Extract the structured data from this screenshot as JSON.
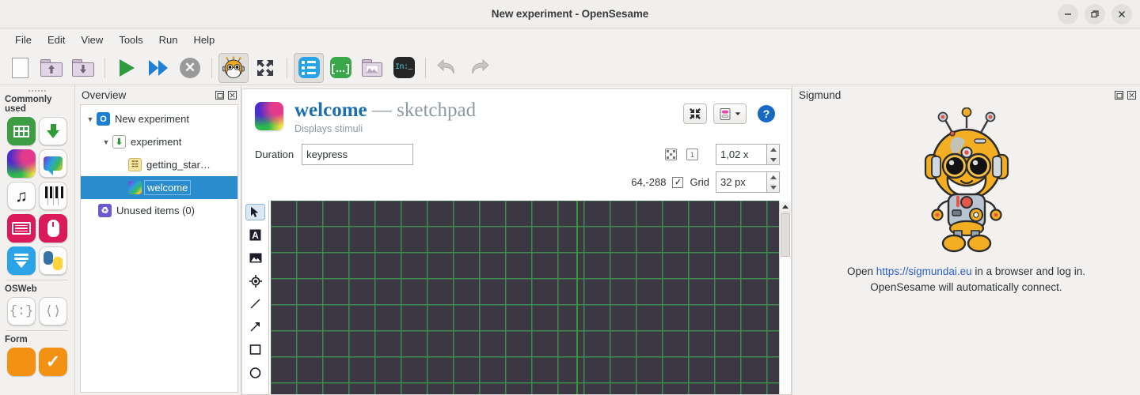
{
  "window": {
    "title": "New experiment - OpenSesame",
    "controls": [
      {
        "name": "minimize",
        "glyph": "minimize-icon"
      },
      {
        "name": "maximize",
        "glyph": "maximize-icon"
      },
      {
        "name": "close",
        "glyph": "close-icon"
      }
    ]
  },
  "menubar": {
    "items": [
      {
        "label": "File"
      },
      {
        "label": "Edit"
      },
      {
        "label": "View"
      },
      {
        "label": "Tools"
      },
      {
        "label": "Run"
      },
      {
        "label": "Help"
      }
    ]
  },
  "toolbar": {
    "buttons": [
      {
        "name": "new-file",
        "icon": "new-file-icon",
        "tooltip": "New"
      },
      {
        "name": "open-file",
        "icon": "folder-up-icon",
        "tooltip": "Open"
      },
      {
        "name": "save-file",
        "icon": "folder-down-icon",
        "tooltip": "Save"
      },
      {
        "name": "run-fullscreen",
        "icon": "play-icon",
        "tooltip": "Run fullscreen"
      },
      {
        "name": "run-in-window",
        "icon": "fast-forward-icon",
        "tooltip": "Run in window"
      },
      {
        "name": "quit-experiment",
        "icon": "stop-icon",
        "tooltip": "Quit"
      },
      {
        "name": "run-in-debug",
        "icon": "bug-icon",
        "tooltip": "Run with debugger"
      },
      {
        "name": "toggle-fullscreen-view",
        "icon": "expand-arrows-icon",
        "tooltip": "Fullscreen"
      },
      {
        "name": "toggle-overview",
        "icon": "overview-list-icon",
        "tooltip": "Overview area"
      },
      {
        "name": "toggle-variable-inspector",
        "icon": "variable-inspector-icon",
        "tooltip": "Variable inspector"
      },
      {
        "name": "toggle-file-pool",
        "icon": "file-pool-icon",
        "tooltip": "File pool"
      },
      {
        "name": "toggle-console",
        "icon": "console-icon",
        "tooltip": "Console"
      },
      {
        "name": "undo",
        "icon": "undo-icon",
        "tooltip": "Undo"
      },
      {
        "name": "redo",
        "icon": "redo-icon",
        "tooltip": "Redo"
      }
    ]
  },
  "palette": {
    "sections": [
      {
        "label": "Commonly used",
        "items": [
          {
            "name": "loop-item",
            "icon": "loop-icon"
          },
          {
            "name": "sequence-item",
            "icon": "sequence-icon"
          },
          {
            "name": "sketchpad-item",
            "icon": "sketchpad-icon"
          },
          {
            "name": "feedback-item",
            "icon": "feedback-icon"
          },
          {
            "name": "sampler-item",
            "icon": "sampler-icon"
          },
          {
            "name": "synth-item",
            "icon": "synth-icon"
          },
          {
            "name": "keyboard-response-item",
            "icon": "keyboard-icon"
          },
          {
            "name": "mouse-response-item",
            "icon": "mouse-icon"
          },
          {
            "name": "logger-item",
            "icon": "logger-icon"
          },
          {
            "name": "inline-script-item",
            "icon": "python-icon"
          }
        ]
      },
      {
        "label": "OSWeb",
        "items": [
          {
            "name": "inline-javascript-item",
            "icon": "braces-icon",
            "glyph": "{:}"
          },
          {
            "name": "inline-html-item",
            "icon": "angle-brackets-icon",
            "glyph": "⟨⟩"
          }
        ]
      },
      {
        "label": "Form",
        "items": [
          {
            "name": "form-base-item",
            "icon": "form-icon"
          },
          {
            "name": "form-consent-item",
            "icon": "form-consent-icon"
          }
        ]
      }
    ]
  },
  "overview": {
    "title": "Overview",
    "dock_buttons": [
      {
        "name": "float-overview",
        "icon": "undock-icon"
      },
      {
        "name": "close-overview",
        "icon": "close-dock-icon"
      }
    ],
    "tree": [
      {
        "label": "New experiment",
        "icon": "experiment-icon",
        "indent": 0,
        "twisty": "▼",
        "selected": false
      },
      {
        "label": "experiment",
        "icon": "sequence-icon",
        "indent": 1,
        "twisty": "▼",
        "selected": false
      },
      {
        "label": "getting_star…",
        "icon": "notepad-icon",
        "indent": 2,
        "twisty": "",
        "selected": false
      },
      {
        "label": "welcome",
        "icon": "sketchpad-icon",
        "indent": 2,
        "twisty": "",
        "selected": true
      },
      {
        "label": "Unused items (0)",
        "icon": "recycle-icon",
        "indent": 0,
        "twisty": "",
        "selected": false
      }
    ]
  },
  "editor": {
    "item_name": "welcome",
    "dash": "—",
    "item_type": "sketchpad",
    "subtitle": "Displays stimuli",
    "header_buttons": [
      {
        "name": "fullscreen-editor-button",
        "icon": "collapse-arrows-icon"
      },
      {
        "name": "view-mode-button",
        "icon": "script-view-icon"
      },
      {
        "name": "help-button",
        "icon": "help-icon"
      }
    ],
    "duration": {
      "label": "Duration",
      "value": "keypress",
      "placeholder": "keypress"
    },
    "zoom": {
      "fit_icon": "zoom-fit-icon",
      "reset_icon": "zoom-reset-icon",
      "value": "1,02 x"
    },
    "grid": {
      "coordinates": "64,-288",
      "checked": true,
      "check_glyph": "✓",
      "label": "Grid",
      "size": "32 px"
    },
    "tools": [
      {
        "name": "select-tool",
        "icon": "cursor-icon",
        "active": true
      },
      {
        "name": "text-tool",
        "icon": "text-icon",
        "active": false
      },
      {
        "name": "image-tool",
        "icon": "image-icon",
        "active": false
      },
      {
        "name": "fixation-dot-tool",
        "icon": "fixation-dot-icon",
        "active": false
      },
      {
        "name": "line-tool",
        "icon": "line-icon",
        "active": false
      },
      {
        "name": "arrow-tool",
        "icon": "arrow-icon",
        "active": false
      },
      {
        "name": "rect-tool",
        "icon": "rectangle-icon",
        "active": false
      },
      {
        "name": "ellipse-tool",
        "icon": "ellipse-icon",
        "active": false
      }
    ],
    "canvas": {
      "background_color": "#3b3844",
      "grid_color": "#3e8c4e",
      "grid_spacing_px": 33
    }
  },
  "sigmund": {
    "title": "Sigmund",
    "dock_buttons": [
      {
        "name": "float-sigmund",
        "icon": "undock-icon"
      },
      {
        "name": "close-sigmund",
        "icon": "close-dock-icon"
      }
    ],
    "robot_icon": "sigmund-robot-icon",
    "message_prefix": "Open ",
    "link_text": "https://sigmundai.eu",
    "message_suffix": " in a browser and log in.",
    "message_line2": "OpenSesame will automatically connect."
  },
  "colors": {
    "accent_blue": "#2a8ccc",
    "link_blue": "#2a5fc8",
    "title_blue": "#1a6fb0",
    "canvas_bg": "#3b3844",
    "grid_green": "#3e8c4e"
  }
}
